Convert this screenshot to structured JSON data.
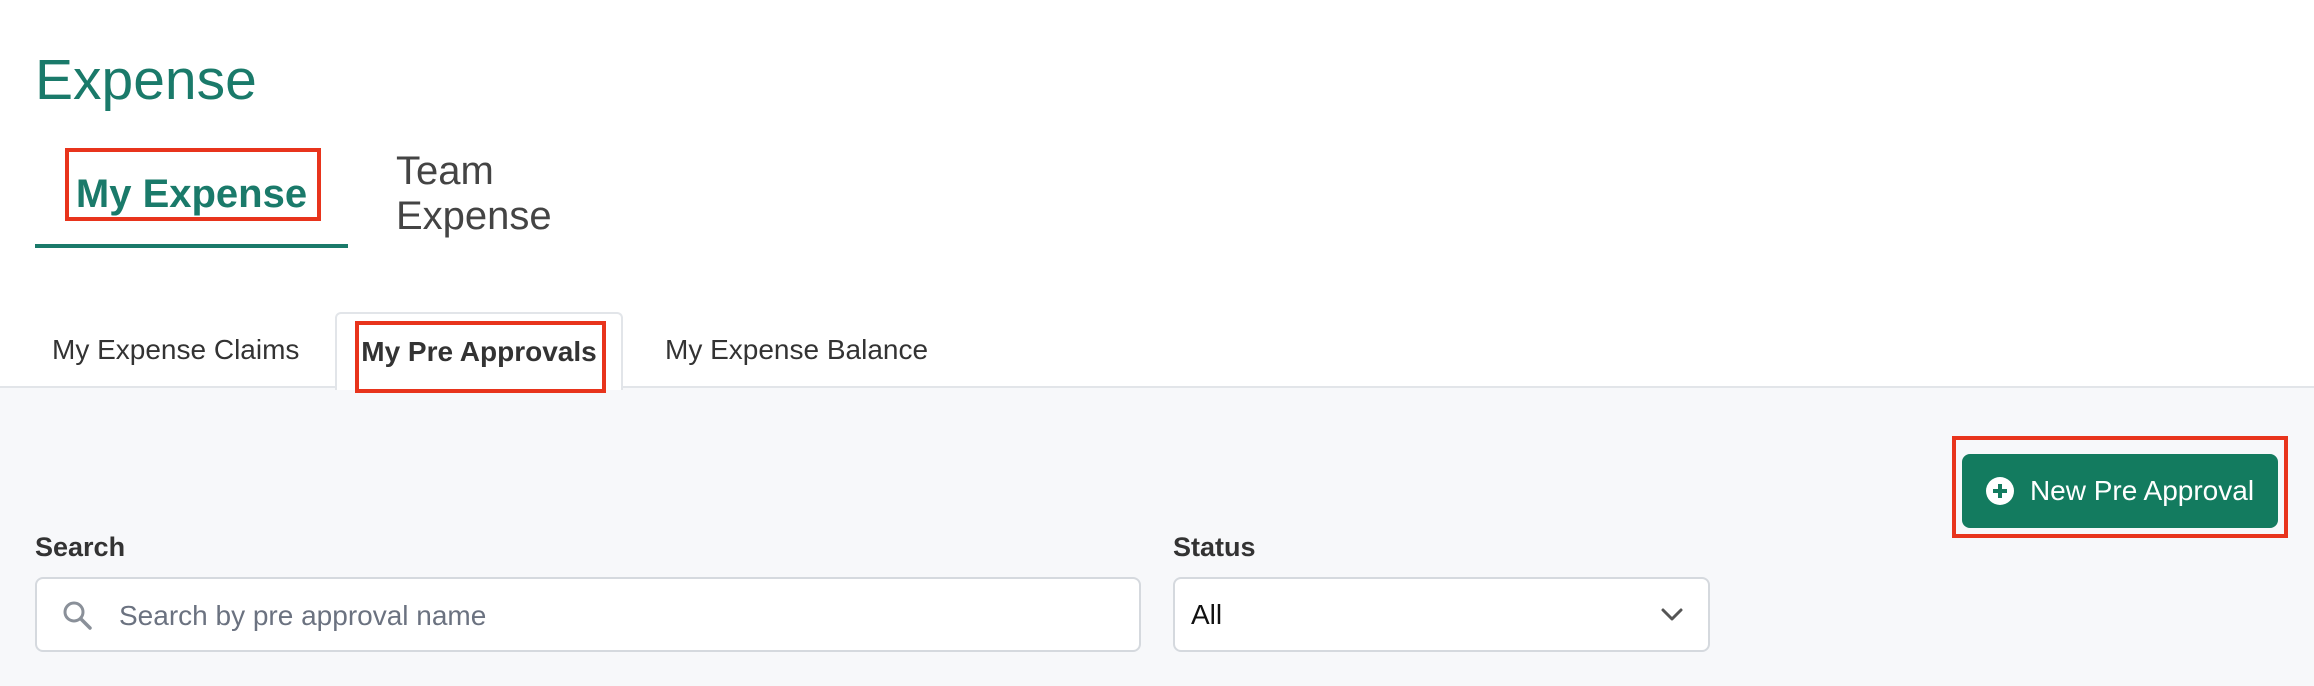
{
  "page": {
    "title": "Expense"
  },
  "primary_tabs": {
    "my_expense": "My Expense",
    "team_expense": "Team Expense"
  },
  "secondary_tabs": {
    "claims": "My Expense Claims",
    "pre_approvals": "My Pre Approvals",
    "balance": "My Expense Balance"
  },
  "actions": {
    "new_pre_approval": "New Pre Approval",
    "icon": "plus-circle-icon"
  },
  "filters": {
    "search_label": "Search",
    "search_placeholder": "Search by pre approval name",
    "search_value": "",
    "status_label": "Status",
    "status_value": "All"
  },
  "colors": {
    "accent": "#1a7a6a",
    "button": "#137b5f",
    "highlight": "#e8341c"
  }
}
